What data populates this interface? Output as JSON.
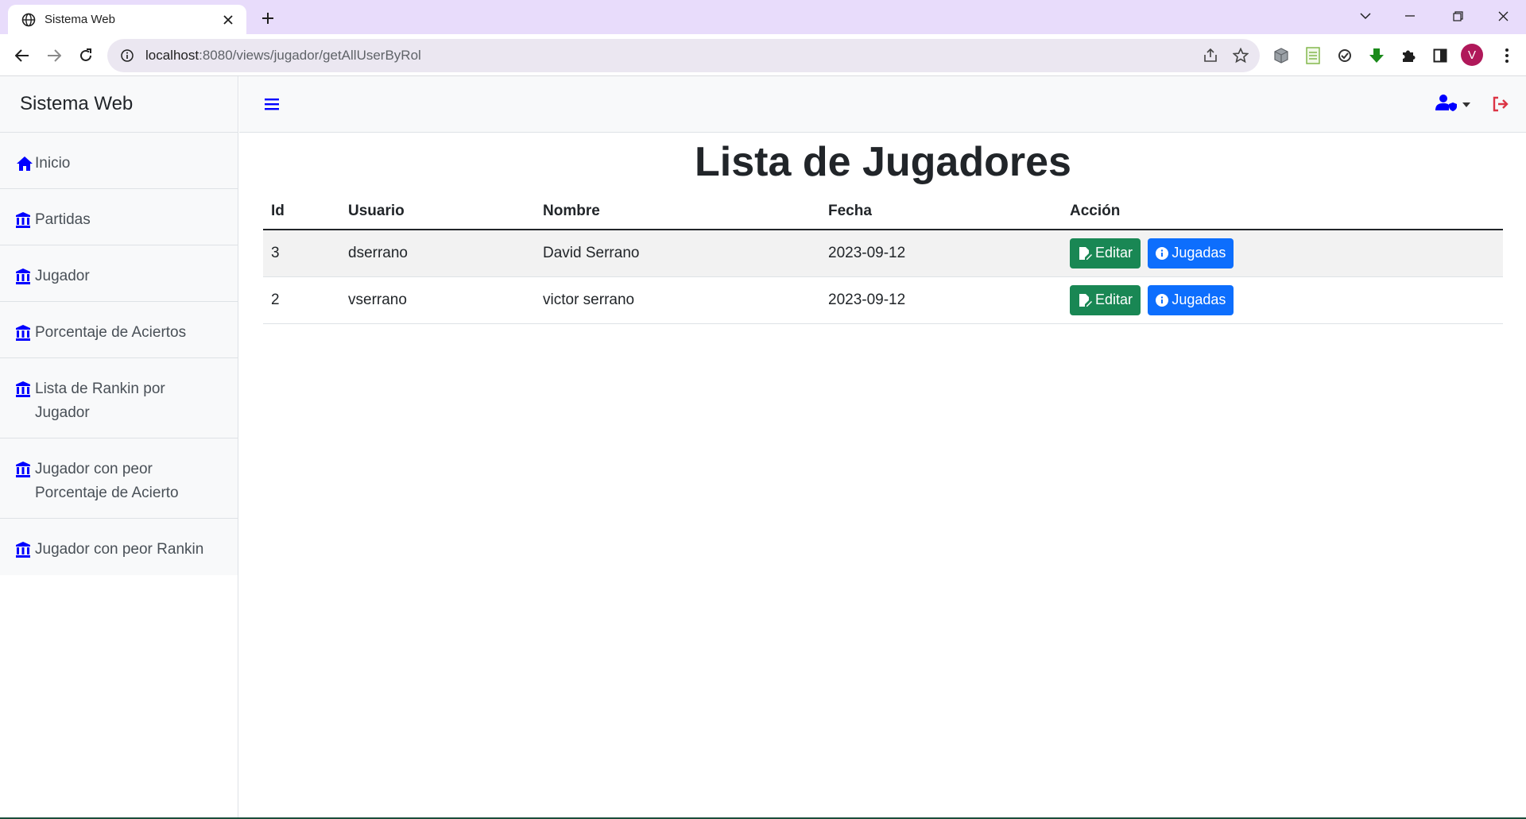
{
  "browser": {
    "tab_title": "Sistema Web",
    "url_host": "localhost",
    "url_path": ":8080/views/jugador/getAllUserByRol",
    "profile_initial": "V"
  },
  "app": {
    "brand": "Sistema Web",
    "accent_color": "#0000ff",
    "logout_color": "#dc3545"
  },
  "sidebar": {
    "items": [
      {
        "label": "Inicio",
        "icon": "home-icon"
      },
      {
        "label": "Partidas",
        "icon": "building-icon"
      },
      {
        "label": "Jugador",
        "icon": "building-icon"
      },
      {
        "label": "Porcentaje de Aciertos",
        "icon": "building-icon"
      },
      {
        "label": "Lista de Rankin por Jugador",
        "icon": "building-icon"
      },
      {
        "label": "Jugador con peor Porcentaje de Acierto",
        "icon": "building-icon"
      },
      {
        "label": "Jugador con peor Rankin",
        "icon": "building-icon"
      }
    ]
  },
  "main": {
    "title": "Lista de Jugadores",
    "table": {
      "headers": [
        "Id",
        "Usuario",
        "Nombre",
        "Fecha",
        "Acción"
      ],
      "rows": [
        {
          "id": "3",
          "usuario": "dserrano",
          "nombre": "David Serrano",
          "fecha": "2023-09-12"
        },
        {
          "id": "2",
          "usuario": "vserrano",
          "nombre": "victor serrano",
          "fecha": "2023-09-12"
        }
      ],
      "edit_label": "Editar",
      "plays_label": "Jugadas"
    }
  }
}
